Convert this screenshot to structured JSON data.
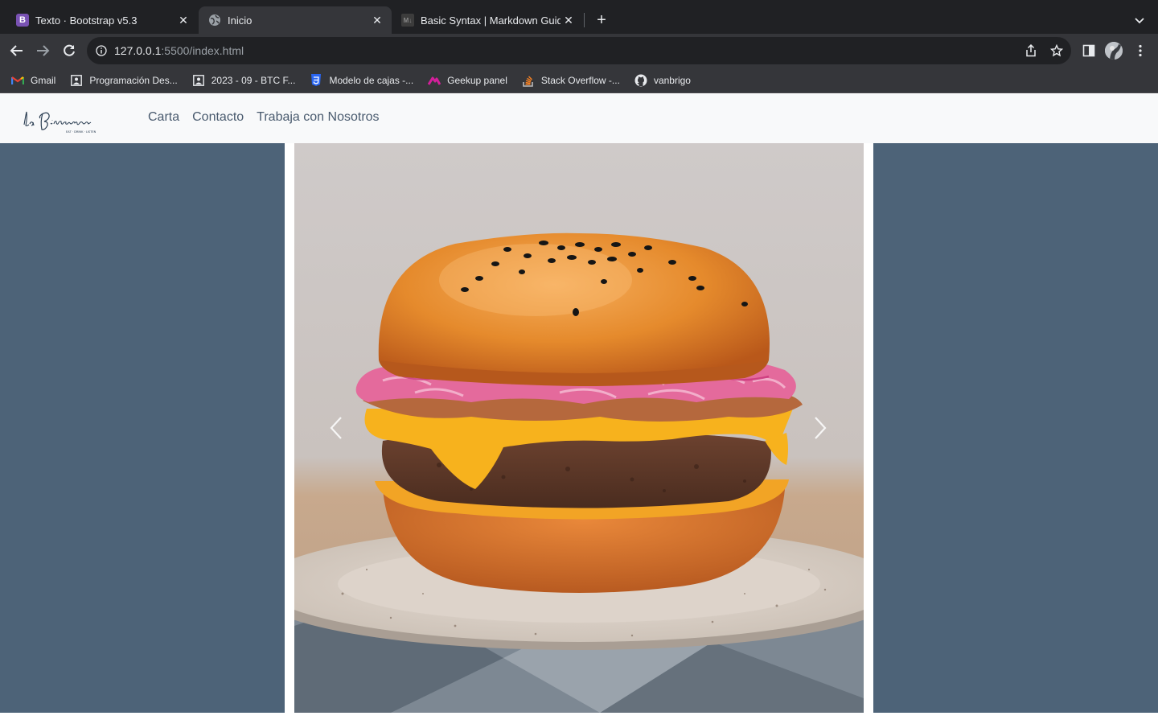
{
  "browser": {
    "tabs": [
      {
        "title": "Texto · Bootstrap v5.3",
        "favicon": "bootstrap-icon",
        "active": false
      },
      {
        "title": "Inicio",
        "favicon": "globe-icon",
        "active": true
      },
      {
        "title": "Basic Syntax | Markdown Guide",
        "favicon": "markdown-icon",
        "active": false
      }
    ],
    "address": {
      "host": "127.0.0.1",
      "path": ":5500/index.html"
    },
    "bookmarks": [
      {
        "label": "Gmail",
        "icon": "gmail-icon"
      },
      {
        "label": "Programación Des...",
        "icon": "page-icon"
      },
      {
        "label": "2023 - 09 - BTC F...",
        "icon": "page-icon"
      },
      {
        "label": "Modelo de cajas -...",
        "icon": "css3-icon"
      },
      {
        "label": "Geekup panel",
        "icon": "geekup-icon"
      },
      {
        "label": "Stack Overflow -...",
        "icon": "stackoverflow-icon"
      },
      {
        "label": "vanbrigo",
        "icon": "github-icon"
      }
    ]
  },
  "site": {
    "logo_text": "la Birreria",
    "logo_tagline": "EAT · DRINK · LISTEN",
    "nav": [
      {
        "label": "Carta"
      },
      {
        "label": "Contacto"
      },
      {
        "label": "Trabaja con Nosotros"
      }
    ]
  },
  "carousel": {
    "image": "burger-photo",
    "colors": {
      "side_panels": "#4d6378",
      "navbar": "#f8f9fa",
      "nav_link": "#495a6e"
    }
  }
}
